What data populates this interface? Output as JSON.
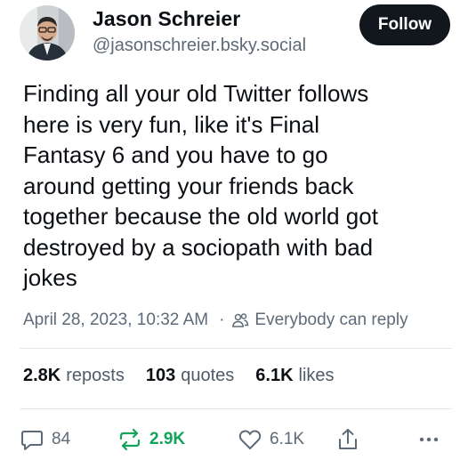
{
  "author": {
    "display_name": "Jason Schreier",
    "handle": "@jasonschreier.bsky.social"
  },
  "follow_button": {
    "label": "Follow"
  },
  "post": {
    "text": "Finding all your old Twitter follows\nhere is very fun, like it's Final\nFantasy 6 and you have to go\naround getting your friends back\ntogether because the old world got\ndestroyed by a sociopath with bad\njokes",
    "timestamp": "April 28, 2023, 10:32 AM",
    "separator": "·",
    "reply_setting": "Everybody can reply"
  },
  "stats": {
    "reposts": {
      "count": "2.8K",
      "label": "reposts"
    },
    "quotes": {
      "count": "103",
      "label": "quotes"
    },
    "likes": {
      "count": "6.1K",
      "label": "likes"
    }
  },
  "actions": {
    "reply_count": "84",
    "repost_count": "2.9K",
    "like_count": "6.1K"
  },
  "icons": {
    "avatar": "avatar-photo",
    "reply_setting": "people-icon",
    "reply": "speech-bubble-icon",
    "repost": "repost-arrows-icon",
    "like": "heart-icon",
    "share": "share-icon",
    "more": "ellipsis-icon"
  },
  "colors": {
    "follow_bg": "#12171d",
    "repost_active": "#13a35a",
    "muted_text": "#5e6a77"
  }
}
